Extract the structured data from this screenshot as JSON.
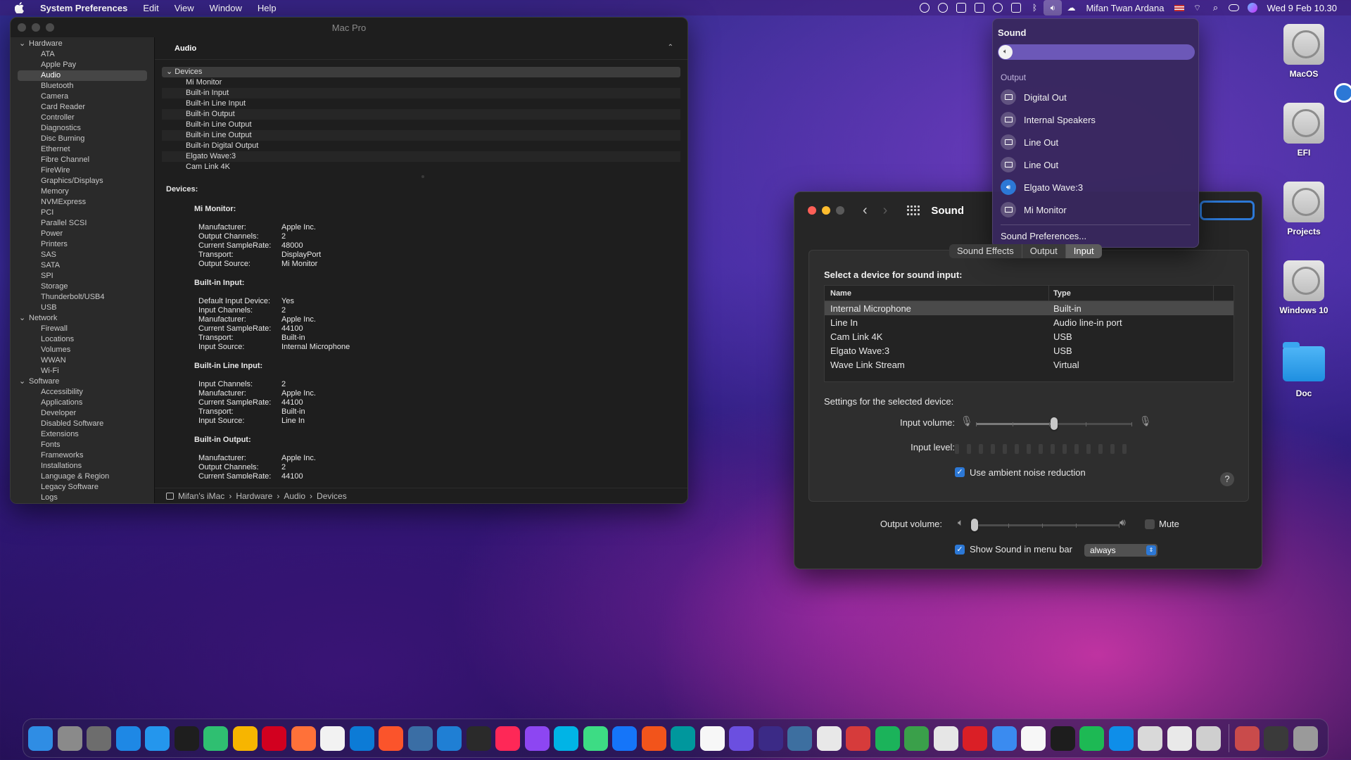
{
  "menubar": {
    "items": [
      "System Preferences",
      "Edit",
      "View",
      "Window",
      "Help"
    ],
    "user": "Mifan Twan Ardana",
    "datetime": "Wed 9 Feb  10.30"
  },
  "sysinfo": {
    "window_title": "Mac Pro",
    "sidebar": [
      {
        "label": "Hardware",
        "group": true
      },
      {
        "label": "ATA"
      },
      {
        "label": "Apple Pay"
      },
      {
        "label": "Audio",
        "selected": true
      },
      {
        "label": "Bluetooth"
      },
      {
        "label": "Camera"
      },
      {
        "label": "Card Reader"
      },
      {
        "label": "Controller"
      },
      {
        "label": "Diagnostics"
      },
      {
        "label": "Disc Burning"
      },
      {
        "label": "Ethernet"
      },
      {
        "label": "Fibre Channel"
      },
      {
        "label": "FireWire"
      },
      {
        "label": "Graphics/Displays"
      },
      {
        "label": "Memory"
      },
      {
        "label": "NVMExpress"
      },
      {
        "label": "PCI"
      },
      {
        "label": "Parallel SCSI"
      },
      {
        "label": "Power"
      },
      {
        "label": "Printers"
      },
      {
        "label": "SAS"
      },
      {
        "label": "SATA"
      },
      {
        "label": "SPI"
      },
      {
        "label": "Storage"
      },
      {
        "label": "Thunderbolt/USB4"
      },
      {
        "label": "USB"
      },
      {
        "label": "Network",
        "group": true
      },
      {
        "label": "Firewall"
      },
      {
        "label": "Locations"
      },
      {
        "label": "Volumes"
      },
      {
        "label": "WWAN"
      },
      {
        "label": "Wi-Fi"
      },
      {
        "label": "Software",
        "group": true
      },
      {
        "label": "Accessibility"
      },
      {
        "label": "Applications"
      },
      {
        "label": "Developer"
      },
      {
        "label": "Disabled Software"
      },
      {
        "label": "Extensions"
      },
      {
        "label": "Fonts"
      },
      {
        "label": "Frameworks"
      },
      {
        "label": "Installations"
      },
      {
        "label": "Language & Region"
      },
      {
        "label": "Legacy Software"
      },
      {
        "label": "Logs"
      }
    ],
    "section_title": "Audio",
    "device_group": "Devices",
    "devices": [
      "Mi Monitor",
      "Built-in Input",
      "Built-in Line Input",
      "Built-in Output",
      "Built-in Line Output",
      "Built-in Line Output",
      "Built-in Digital Output",
      "Elgato Wave:3",
      "Cam Link 4K"
    ],
    "detail_heading": "Devices:",
    "detail_blocks": [
      {
        "title": "Mi Monitor:",
        "rows": [
          [
            "Manufacturer:",
            "Apple Inc."
          ],
          [
            "Output Channels:",
            "2"
          ],
          [
            "Current SampleRate:",
            "48000"
          ],
          [
            "Transport:",
            "DisplayPort"
          ],
          [
            "Output Source:",
            "Mi Monitor"
          ]
        ]
      },
      {
        "title": "Built-in Input:",
        "rows": [
          [
            "Default Input Device:",
            "Yes"
          ],
          [
            "Input Channels:",
            "2"
          ],
          [
            "Manufacturer:",
            "Apple Inc."
          ],
          [
            "Current SampleRate:",
            "44100"
          ],
          [
            "Transport:",
            "Built-in"
          ],
          [
            "Input Source:",
            "Internal Microphone"
          ]
        ]
      },
      {
        "title": "Built-in Line Input:",
        "rows": [
          [
            "Input Channels:",
            "2"
          ],
          [
            "Manufacturer:",
            "Apple Inc."
          ],
          [
            "Current SampleRate:",
            "44100"
          ],
          [
            "Transport:",
            "Built-in"
          ],
          [
            "Input Source:",
            "Line In"
          ]
        ]
      },
      {
        "title": "Built-in Output:",
        "rows": [
          [
            "Manufacturer:",
            "Apple Inc."
          ],
          [
            "Output Channels:",
            "2"
          ],
          [
            "Current SampleRate:",
            "44100"
          ]
        ]
      }
    ],
    "path": [
      "Mifan's iMac",
      "Hardware",
      "Audio",
      "Devices"
    ]
  },
  "sound_window": {
    "title": "Sound",
    "tabs": [
      "Sound Effects",
      "Output",
      "Input"
    ],
    "active_tab": "Input",
    "select_label": "Select a device for sound input:",
    "columns": [
      "Name",
      "Type"
    ],
    "rows": [
      {
        "name": "Internal Microphone",
        "type": "Built-in",
        "selected": true
      },
      {
        "name": "Line In",
        "type": "Audio line-in port"
      },
      {
        "name": "Cam Link 4K",
        "type": "USB"
      },
      {
        "name": "Elgato Wave:3",
        "type": "USB"
      },
      {
        "name": "Wave Link Stream",
        "type": "Virtual"
      }
    ],
    "settings_label": "Settings for the selected device:",
    "input_volume_label": "Input volume:",
    "input_volume_value": 0.5,
    "input_level_label": "Input level:",
    "noise_reduction_label": "Use ambient noise reduction",
    "noise_reduction_checked": true,
    "output_volume_label": "Output volume:",
    "output_volume_value": 0.0,
    "mute_label": "Mute",
    "mute_checked": false,
    "show_in_menubar_label": "Show Sound in menu bar",
    "show_in_menubar_checked": true,
    "menubar_option": "always"
  },
  "sound_menu": {
    "title": "Sound",
    "volume_value": 0.0,
    "output_label": "Output",
    "outputs": [
      {
        "label": "Digital Out"
      },
      {
        "label": "Internal Speakers"
      },
      {
        "label": "Line Out"
      },
      {
        "label": "Line Out"
      },
      {
        "label": "Elgato Wave:3",
        "selected": true
      },
      {
        "label": "Mi Monitor"
      }
    ],
    "prefs_label": "Sound Preferences..."
  },
  "desktop": {
    "icons": [
      "MacOS",
      "EFI",
      "Projects",
      "Windows 10",
      "Doc"
    ]
  },
  "dock": {
    "apps": [
      {
        "name": "finder",
        "color": "#2f8de4"
      },
      {
        "name": "launchpad",
        "color": "#8a8a8a"
      },
      {
        "name": "system-preferences",
        "color": "#6d6d6d"
      },
      {
        "name": "app-store",
        "color": "#1e88e5"
      },
      {
        "name": "docker",
        "color": "#2496ed"
      },
      {
        "name": "figma",
        "color": "#1e1e1e"
      },
      {
        "name": "maps-app",
        "color": "#2fbf71"
      },
      {
        "name": "sketch",
        "color": "#f7b500"
      },
      {
        "name": "opera",
        "color": "#d2001f"
      },
      {
        "name": "firefox",
        "color": "#ff7139"
      },
      {
        "name": "chrome",
        "color": "#f2f2f2"
      },
      {
        "name": "edge",
        "color": "#0c7bd6"
      },
      {
        "name": "brave",
        "color": "#fb542b"
      },
      {
        "name": "cube-app",
        "color": "#3a6ea5"
      },
      {
        "name": "vscode",
        "color": "#1f7fd4"
      },
      {
        "name": "gitkraken",
        "color": "#2a2a2a"
      },
      {
        "name": "intellij",
        "color": "#fe2857"
      },
      {
        "name": "phpstorm",
        "color": "#8d46f2"
      },
      {
        "name": "webstorm",
        "color": "#00b4e6"
      },
      {
        "name": "androidstudio",
        "color": "#3ddc84"
      },
      {
        "name": "xcode",
        "color": "#1575f9"
      },
      {
        "name": "slides-app",
        "color": "#f2541b"
      },
      {
        "name": "arduino",
        "color": "#00979d"
      },
      {
        "name": "notion",
        "color": "#f7f7f7"
      },
      {
        "name": "editor-app",
        "color": "#6b4fe0"
      },
      {
        "name": "eclipse",
        "color": "#3b2a86"
      },
      {
        "name": "mysql-workbench",
        "color": "#3d6fa0"
      },
      {
        "name": "tableplus",
        "color": "#e8e8e8"
      },
      {
        "name": "sequel",
        "color": "#d63b3b"
      },
      {
        "name": "cloud-app",
        "color": "#1bb35a"
      },
      {
        "name": "rocket-app",
        "color": "#3aa04a"
      },
      {
        "name": "github",
        "color": "#e6e6e6"
      },
      {
        "name": "creative-cloud",
        "color": "#da1f26"
      },
      {
        "name": "mail",
        "color": "#3a8bf0"
      },
      {
        "name": "calendar",
        "color": "#f7f7f7"
      },
      {
        "name": "terminal",
        "color": "#1d1d1d"
      },
      {
        "name": "spotify",
        "color": "#1db954"
      },
      {
        "name": "teamviewer",
        "color": "#0e8ee9"
      },
      {
        "name": "preview",
        "color": "#d9d9d9"
      },
      {
        "name": "textedit",
        "color": "#e9e9e9"
      },
      {
        "name": "printer",
        "color": "#cfcfcf"
      }
    ],
    "recent": [
      {
        "name": "photo-stack",
        "color": "#c94b4b"
      },
      {
        "name": "screen-recorder",
        "color": "#3a3a3a"
      },
      {
        "name": "trash",
        "color": "#9a9a9a"
      }
    ]
  }
}
